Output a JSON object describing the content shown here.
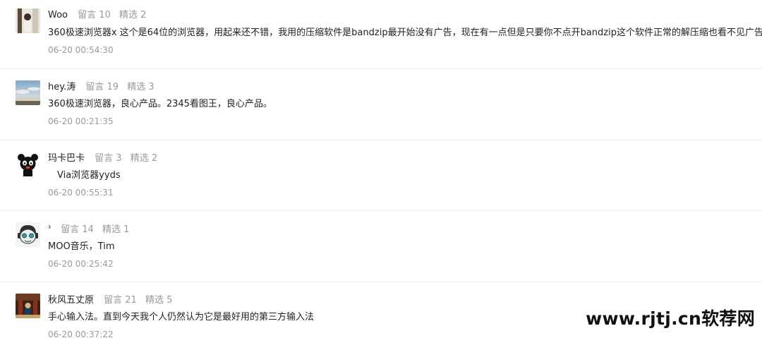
{
  "comments": [
    {
      "name": "Woo",
      "messages": "留言 10",
      "featured": "精选 2",
      "text": "360极速浏览器x 这个是64位的浏览器，用起来还不错，我用的压缩软件是bandzip最开始没有广告，现在有一点但是只要你不点开bandzip这个软件正常的解压缩也看不见广告",
      "emoji": "cat-face-emoji",
      "time": "06-20 00:54:30"
    },
    {
      "name": "hey.涛",
      "messages": "留言 19",
      "featured": "精选 3",
      "text": "360极速浏览器，良心产品。2345看图王，良心产品。",
      "time": "06-20 00:21:35"
    },
    {
      "name": "玛卡巴卡",
      "messages": "留言 3",
      "featured": "精选 2",
      "text": "　Via浏览器yyds",
      "time": "06-20 00:55:31"
    },
    {
      "name": "³",
      "messages": "留言 14",
      "featured": "精选 1",
      "text": "MOO音乐，Tim",
      "time": "06-20 00:25:42"
    },
    {
      "name": "秋风五丈原",
      "messages": "留言 21",
      "featured": "精选 5",
      "text": "手心输入法。直到今天我个人仍然认为它是最好用的第三方输入法",
      "time": "06-20 00:37:22"
    }
  ],
  "watermark": "www.rjtj.cn软荐网"
}
